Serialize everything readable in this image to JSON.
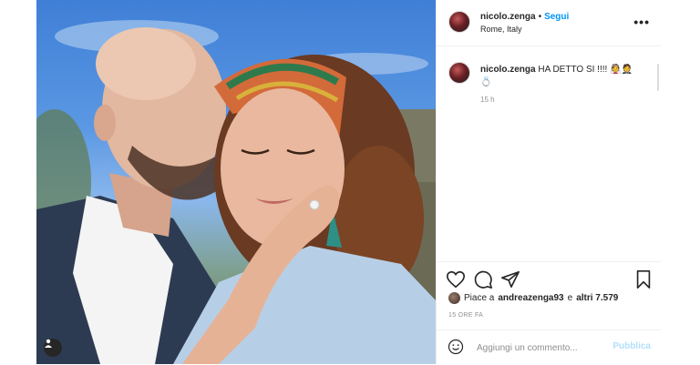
{
  "post": {
    "username": "nicolo.zenga",
    "dot": "•",
    "follow_label": "Segui",
    "location": "Rome, Italy",
    "more_label": "•••",
    "caption_username": "nicolo.zenga",
    "caption_text": "HA DETTO SI !!!! 👰🤵 💍",
    "caption_time": "15 h",
    "likes_prefix": "Piace a",
    "likes_user": "andreazenga93",
    "likes_mid": "e",
    "likes_others": "altri 7.579",
    "time_ago": "15 ORE FA"
  },
  "comment": {
    "placeholder": "Aggiungi un commento...",
    "publish_label": "Pubblica"
  },
  "icons": {
    "like": "heart-icon",
    "comment": "comment-icon",
    "share": "send-icon",
    "save": "bookmark-icon",
    "emoji": "smiley-icon",
    "tagged_user": "user-icon"
  },
  "colors": {
    "link_blue": "#0095f6",
    "publish_disabled": "#b2dffc",
    "muted_text": "#8e8e8e",
    "border": "#dbdbdb"
  }
}
